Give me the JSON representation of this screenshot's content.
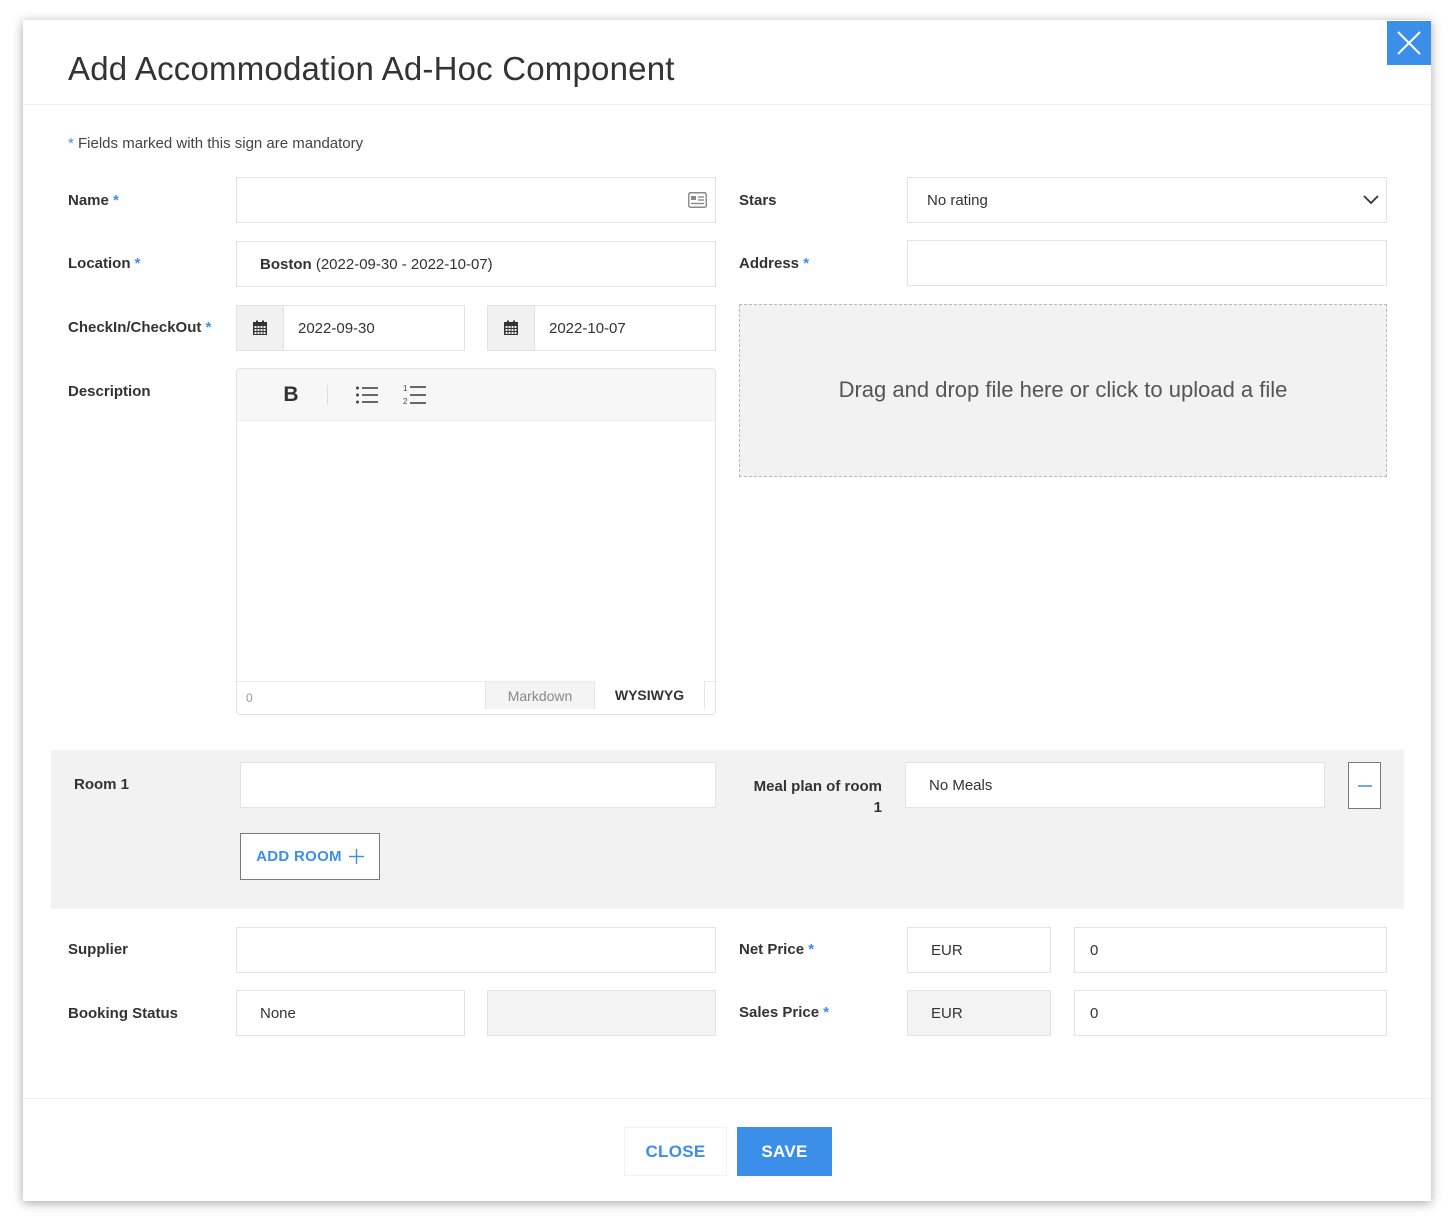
{
  "dialog": {
    "title": "Add Accommodation Ad-Hoc Component",
    "mandatory_star": "*",
    "mandatory_note": "Fields marked with this sign are mandatory"
  },
  "form": {
    "name": {
      "label": "Name",
      "value": ""
    },
    "stars": {
      "label": "Stars",
      "value": "No rating"
    },
    "location": {
      "label": "Location",
      "city": "Boston",
      "range": "(2022-09-30 - 2022-10-07)"
    },
    "address": {
      "label": "Address",
      "value": ""
    },
    "checkin_checkout": {
      "label": "CheckIn/CheckOut",
      "checkin": "2022-09-30",
      "checkout": "2022-10-07"
    },
    "description": {
      "label": "Description",
      "char_count": "0",
      "tab_markdown": "Markdown",
      "tab_wysiwyg": "WYSIWYG",
      "bold_glyph": "B"
    },
    "upload": {
      "text": "Drag and drop file here or click to upload a file"
    }
  },
  "rooms": {
    "room_label": "Room 1",
    "room_value": "",
    "meal_label_line1": "Meal plan of room",
    "meal_label_line2": "1",
    "meal_value": "No Meals",
    "add_room_label": "ADD ROOM"
  },
  "pricing": {
    "supplier": {
      "label": "Supplier",
      "value": ""
    },
    "booking_status": {
      "label": "Booking Status",
      "value": "None",
      "extra": ""
    },
    "net_price": {
      "label": "Net Price",
      "currency": "EUR",
      "amount": "0"
    },
    "sales_price": {
      "label": "Sales Price",
      "currency": "EUR",
      "amount": "0"
    }
  },
  "actions": {
    "close_label": "CLOSE",
    "save_label": "SAVE"
  },
  "colors": {
    "accent": "#3b8fe8",
    "section_bg": "#f2f2f2"
  }
}
